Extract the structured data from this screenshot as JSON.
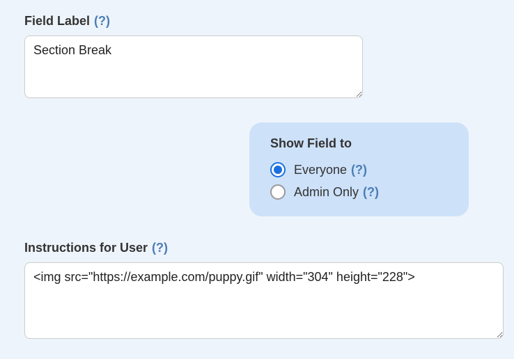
{
  "fieldLabel": {
    "title": "Field Label",
    "help": "(?)",
    "value": "Section Break"
  },
  "showField": {
    "title": "Show Field to",
    "options": [
      {
        "label": "Everyone",
        "help": "(?)",
        "checked": true
      },
      {
        "label": "Admin Only",
        "help": "(?)",
        "checked": false
      }
    ]
  },
  "instructions": {
    "title": "Instructions for User",
    "help": "(?)",
    "value": "<img src=\"https://example.com/puppy.gif\" width=\"304\" height=\"228\">"
  }
}
